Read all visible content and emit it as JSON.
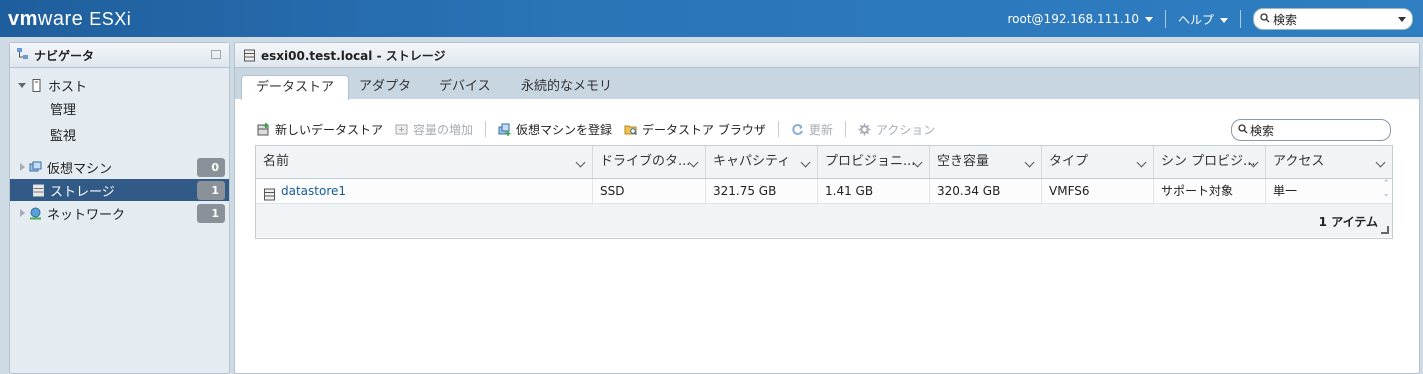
{
  "brand": {
    "vm": "vm",
    "ware": "ware",
    "product": "ESXi"
  },
  "header": {
    "user": "root@192.168.111.10",
    "help": "ヘルプ",
    "search_placeholder": "検索"
  },
  "navigator": {
    "title": "ナビゲータ",
    "items": [
      {
        "label": "ホスト"
      },
      {
        "label": "管理"
      },
      {
        "label": "監視"
      },
      {
        "label": "仮想マシン",
        "count": "0"
      },
      {
        "label": "ストレージ",
        "count": "1"
      },
      {
        "label": "ネットワーク",
        "count": "1"
      }
    ]
  },
  "main": {
    "title": "esxi00.test.local - ストレージ",
    "tabs": [
      {
        "label": "データストア"
      },
      {
        "label": "アダプタ"
      },
      {
        "label": "デバイス"
      },
      {
        "label": "永続的なメモリ"
      }
    ],
    "toolbar": {
      "new_datastore": "新しいデータストア",
      "increase_capacity": "容量の増加",
      "register_vm": "仮想マシンを登録",
      "datastore_browser": "データストア ブラウザ",
      "refresh": "更新",
      "actions": "アクション",
      "search_placeholder": "検索"
    },
    "table": {
      "columns": [
        "名前",
        "ドライブのタ...",
        "キャパシティ",
        "プロビジョニ...",
        "空き容量",
        "タイプ",
        "シン プロビジ...",
        "アクセス"
      ],
      "rows": [
        [
          "datastore1",
          "SSD",
          "321.75 GB",
          "1.41 GB",
          "320.34 GB",
          "VMFS6",
          "サポート対象",
          "単一"
        ]
      ],
      "footer": "1 アイテム"
    }
  }
}
